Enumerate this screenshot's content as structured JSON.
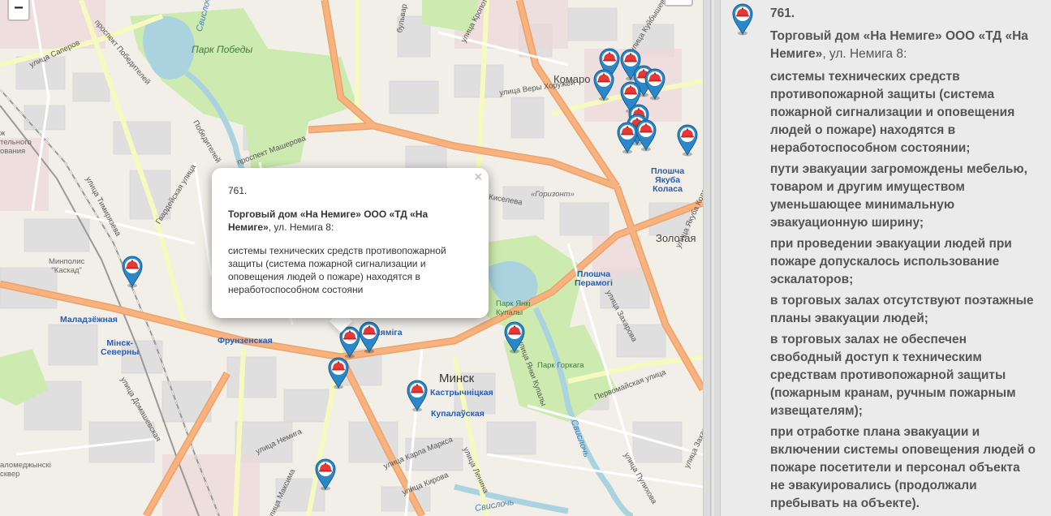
{
  "map": {
    "zoom_out_label": "−",
    "labels": {
      "park_pobedy": "Парк Победы",
      "svisloch_upper": "Свислочь",
      "svisloch_lower": "Свислочь",
      "komarovka": "Комаро",
      "zolotaya": "Золотая",
      "gorizont": "«Горизонт»",
      "minsk": "Минск",
      "park_yanki_kupaly": "Парк Янкі\nКупалы",
      "park_gorkogo": "Парк Горкага",
      "minipolis": "Минполис\n\"Каскад\"",
      "aviation": "ж\nтельного\nования",
      "alexander_square": "аломеджынскi\nсквер",
      "metro_yakuba_kolasa": "Плошча\nЯкуба\nКоласа",
      "metro_peramogi": "Плошча\nПерамогі",
      "metro_frunzenskaya": "Фрунзенская",
      "metro_maladziozhnaya": "Маладзёжная",
      "metro_minsk_severny": "Мінск-\nСеверны",
      "metro_nyamiha": "Нямiга",
      "metro_kastrychnitskaya": "Кастрычніцкая",
      "metro_kupalauskaya": "Купалаўская",
      "st_saperov": "улица Саперов",
      "st_pobediteley_prospekt": "проспект Победителей",
      "st_pobediteley": "Победителей",
      "st_timiryazeva": "улица Тимирязева",
      "st_gvardeyskaya": "Гвардейская улица",
      "st_masherova": "проспект Машерова",
      "st_very_khoruzhey": "улица Веры Хоружей",
      "st_kuybysheva": "улица Куйбышева",
      "st_kropotkina": "улица Кропоткина",
      "st_bulvar": "бульвар",
      "st_yanki_kupaly": "улица Янки Купалы",
      "st_zakharova": "улица Захарова",
      "st_pervomayskaya": "Первомайская улица",
      "st_nemiga": "улица Немига",
      "st_karla_marksa": "улица Карла Маркса",
      "st_lenina": "улица Ленина",
      "st_kirova": "улица Кирова",
      "st_maksima": "улица Максима",
      "st_dolgobrodskaya": "улица Домашевская",
      "st_kiseleva": "Киселева",
      "st_yakuba_kolasa": "улица Якуба Коласа",
      "st_pulikhova": "улица Пулихова",
      "st_zakharova2": "улица Захарова",
      "st_rer": "ьская",
      "st_yaroslav": "улица Я"
    },
    "popup": {
      "number": "761.",
      "name": "Торговый дом «На Немиге» ООО «ТД «На Немиге»",
      "address": ", ул. Немига 8:",
      "text": "системы технических средств противопожарной защиты (система пожарной сигнализации и оповещения людей о пожаре) находятся в неработоспособном состояни",
      "close_label": "×"
    }
  },
  "panel": {
    "number": "761.",
    "name": "Торговый дом «На Немиге» ООО «ТД «На Немиге»",
    "address": ", ул. Немига 8:",
    "violations": [
      "системы технических средств противопожарной защиты (система пожарной сигнализации и оповещения людей о пожаре) находятся в неработоспособном состоянии;",
      "пути эвакуации загромождены мебелью, товаром и другим имуществом уменьшающее минимальную эвакуационную ширину;",
      "при проведении эвакуации людей при пожаре допускалось использование эскалаторов;",
      "в торговых залах отсутствуют поэтажные планы эвакуации людей;",
      "в торговых залах не обеспечен свободный доступ к техническим средствам противопожарной защиты (пожарным кранам, ручным пожарным извещателям);",
      "при отработке плана эвакуации и включении системы оповещения людей о пожаре посетители и персонал объекта не эвакуировались (продолжали пребывать на объекте)."
    ]
  },
  "colors": {
    "map_background": "#f2efe9",
    "park": "#cdebb0",
    "water": "#aad3df",
    "major_road": "#f9b27d",
    "secondary_road": "#f7fabf",
    "marker_blue": "#2a87c9",
    "marker_icon": "#e53935",
    "panel_background": "#ebebeb",
    "panel_text": "#555555"
  },
  "icons": {
    "marker": "fire-inspection-marker-icon",
    "close": "close-icon"
  }
}
